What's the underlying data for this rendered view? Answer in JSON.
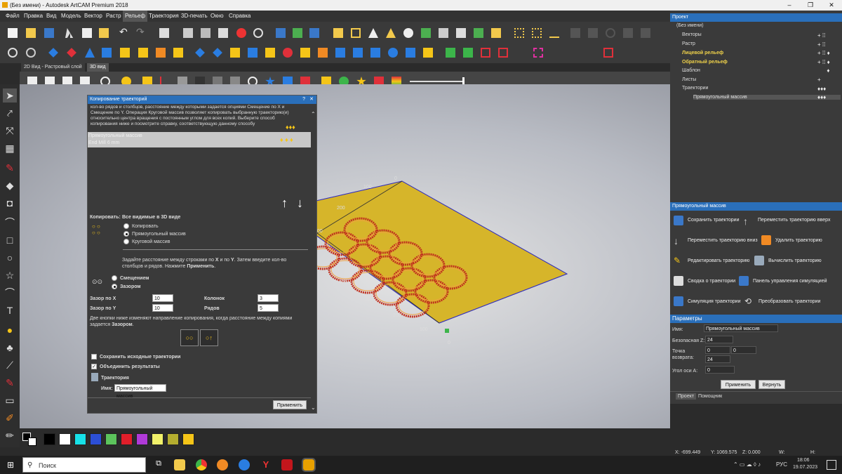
{
  "window": {
    "title": "(Без имени) - Autodesk ArtCAM Premium 2018"
  },
  "menu": [
    "Файл",
    "Правка",
    "Вид",
    "Модель",
    "Вектор",
    "Растр",
    "Рельеф",
    "Траектория",
    "3D-печать",
    "Окно",
    "Справка"
  ],
  "view_tabs": [
    "2D Вид - Растровый слой",
    "3D вид"
  ],
  "dialog": {
    "title": "Копирование траекторий",
    "description": "кол-во рядов и столбцов, расстояние между которыми задается опциями Смещение по X и Смещение по Y. Операция Круговой массив позволяет копировать выбранную траекторию(и) относительно центра вращения с постоянным углом для всех копий. Выберите способ копирования ниже и посмотрите справку, соответствующую данному способу",
    "list_item_title": "Прямоугольный массив",
    "list_item_sub": "End Mill 6 mm",
    "copy_label": "Копировать:",
    "copy_value": "Все видимые в 3D виде",
    "options": [
      "Копировать",
      "Прямоугольный массив",
      "Круговой массив"
    ],
    "hint1_a": "Задайте расстояние между строками по ",
    "hint1_b": "X",
    "hint1_c": " и по ",
    "hint1_d": "Y",
    "hint1_e": ". Затем введите кол-во столбцов и рядов. Нажмите ",
    "hint1_f": "Применить",
    "hint1_g": ".",
    "offset_options": [
      "Смещением",
      "Зазором"
    ],
    "gap_x_label": "Зазор по X",
    "gap_x": "10",
    "gap_y_label": "Зазор по Y",
    "gap_y": "10",
    "cols_label": "Колонок",
    "cols": "3",
    "rows_label": "Рядов",
    "rows": "5",
    "hint2_a": "Две кнопки ниже изменяют направление копирования, когда расстояние между копиями задается ",
    "hint2_b": "Зазором",
    "hint2_c": ".",
    "keep_label": "Сохранить исходные траектории",
    "merge_label": "Объединить результаты",
    "toolpath_label": "Траектория",
    "name_label": "Имя:",
    "name_value": "Прямоугольный массив",
    "apply": "Применить"
  },
  "project": {
    "title": "Проект",
    "root": "(Без имени)",
    "items": [
      "Векторы",
      "Растр",
      "Лицевой рельеф",
      "Обратный рельеф",
      "Шаблон",
      "Листы",
      "Траектории",
      "Прямоугольный массив"
    ]
  },
  "toolpath_panel": {
    "title": "Прямоугольный массив",
    "actions": [
      "Сохранить траектории",
      "Переместить траекторию вверх",
      "Переместить траекторию вниз",
      "Удалить траекторию",
      "Редактировать траекторию",
      "Вычислить траекторию",
      "Сводка о траектории",
      "Панель управления симуляцией",
      "Симуляция траектории",
      "Преобразовать траектории"
    ]
  },
  "params": {
    "title": "Параметры",
    "name_label": "Имя:",
    "name_value": "Прямоугольный массив",
    "safe_z_label": "Безопасная Z:",
    "safe_z": "24",
    "home_label": "Точка возврата:",
    "home_x": "0",
    "home_y": "0",
    "home_z": "24",
    "angle_label": "Угол оси A:",
    "angle": "0",
    "apply": "Применить",
    "revert": "Вернуть"
  },
  "bottom_tabs": [
    "Проект",
    "Помощник"
  ],
  "axis_labels": [
    "0",
    "100",
    "200",
    "300",
    "400",
    "300",
    "200",
    "100",
    "0"
  ],
  "status": {
    "x": "X: -699.449",
    "y": "Y: 1069.575",
    "z": "Z: 0.000",
    "w": "W:",
    "h": "H:"
  },
  "taskbar": {
    "search": "Поиск",
    "lang": "РУС",
    "time": "18:06",
    "date": "19.07.2023"
  },
  "palette": [
    "#000000",
    "#ffffff",
    "#17e1e8",
    "#2c4fd6",
    "#5cc45c",
    "#e01e2a",
    "#b03ad8",
    "#f1f16a",
    "#b4ad2f",
    "#f5c518"
  ]
}
